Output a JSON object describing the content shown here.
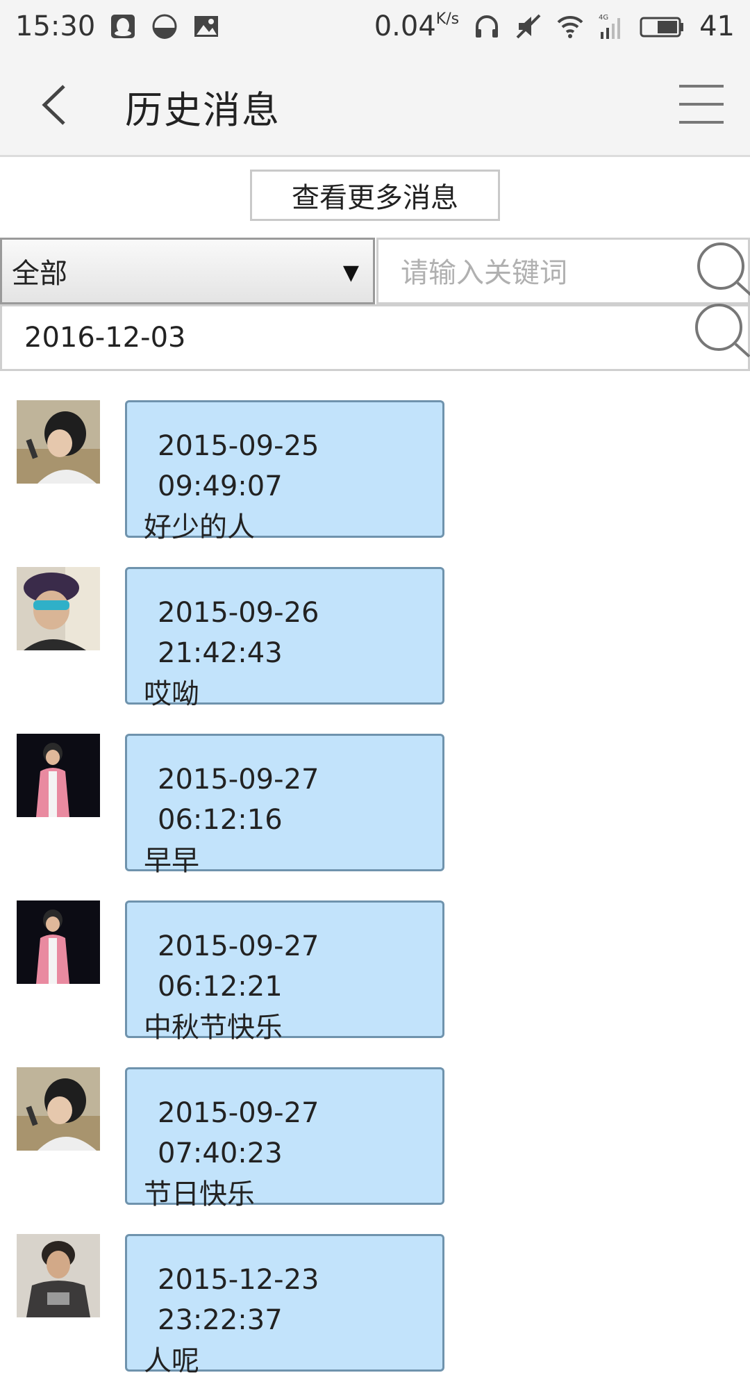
{
  "status_bar": {
    "time": "15:30",
    "net_speed": "0.04",
    "net_unit": "K/s",
    "network_type": "4G",
    "battery": "41",
    "icons": [
      "qq-icon",
      "half-circle-icon",
      "image-icon",
      "headphones-icon",
      "mute-icon",
      "wifi-icon",
      "signal-icon",
      "battery-icon"
    ]
  },
  "header": {
    "title": "历史消息",
    "back_icon": "back-chevron-icon",
    "menu_icon": "menu-icon"
  },
  "more_messages": {
    "label": "查看更多消息"
  },
  "filter": {
    "category_value": "全部",
    "keyword_placeholder": "请输入关键词",
    "keyword_value": "",
    "date_value": "2016-12-03"
  },
  "messages": [
    {
      "time": "2015-09-25 09:49:07",
      "text": "好少的人",
      "avatar": "avatar-1"
    },
    {
      "time": "2015-09-26 21:42:43",
      "text": "哎呦",
      "avatar": "avatar-2"
    },
    {
      "time": "2015-09-27 06:12:16",
      "text": "早早",
      "avatar": "avatar-3"
    },
    {
      "time": "2015-09-27 06:12:21",
      "text": "中秋节快乐",
      "avatar": "avatar-3"
    },
    {
      "time": "2015-09-27 07:40:23",
      "text": "节日快乐",
      "avatar": "avatar-1"
    },
    {
      "time": "2015-12-23 23:22:37",
      "text": "人呢",
      "avatar": "avatar-4"
    }
  ],
  "colors": {
    "bubble_bg": "#c2e3fb",
    "bubble_border": "#6f93ad",
    "header_bg": "#f4f4f4"
  }
}
